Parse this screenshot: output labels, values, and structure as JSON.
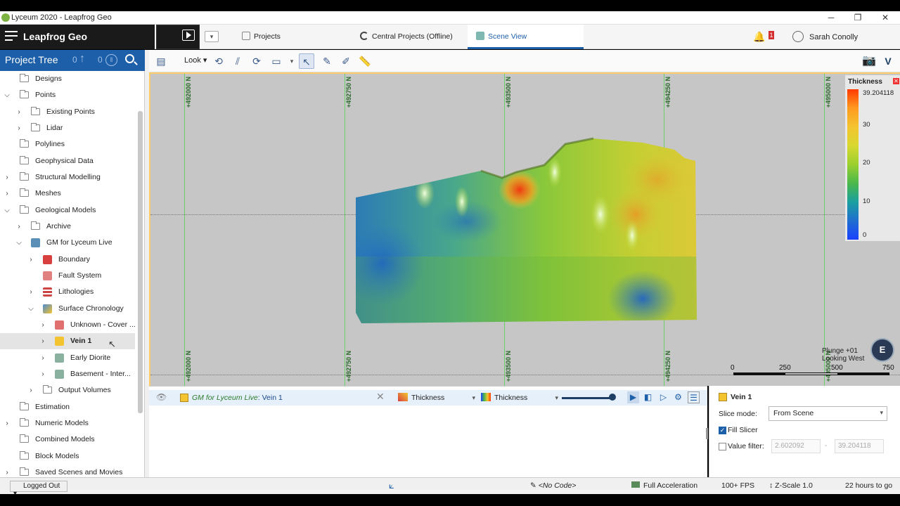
{
  "window": {
    "title": "Lyceum 2020 - Leapfrog Geo",
    "minimize": "─",
    "restore": "❐",
    "close": "✕"
  },
  "app": {
    "name": "Leapfrog Geo"
  },
  "tabs": [
    {
      "label": "Projects"
    },
    {
      "label": "Central Projects (Offline)"
    },
    {
      "label": "Scene View"
    }
  ],
  "notifications": {
    "count": "1"
  },
  "user": {
    "name": "Sarah Conolly"
  },
  "project_tree": {
    "title": "Project Tree",
    "count_a": "0",
    "count_b": "0",
    "items": [
      {
        "label": "Designs"
      },
      {
        "label": "Points"
      },
      {
        "label": "Existing Points"
      },
      {
        "label": "Lidar"
      },
      {
        "label": "Polylines"
      },
      {
        "label": "Geophysical Data"
      },
      {
        "label": "Structural Modelling"
      },
      {
        "label": "Meshes"
      },
      {
        "label": "Geological Models"
      },
      {
        "label": "Archive"
      },
      {
        "label": "GM for Lyceum Live"
      },
      {
        "label": "Boundary"
      },
      {
        "label": "Fault System"
      },
      {
        "label": "Lithologies"
      },
      {
        "label": "Surface Chronology"
      },
      {
        "label": "Unknown - Cover ..."
      },
      {
        "label": "Vein 1"
      },
      {
        "label": "Early Diorite"
      },
      {
        "label": "Basement - Inter..."
      },
      {
        "label": "Output Volumes"
      },
      {
        "label": "Estimation"
      },
      {
        "label": "Numeric Models"
      },
      {
        "label": "Combined Models"
      },
      {
        "label": "Block Models"
      },
      {
        "label": "Saved Scenes and Movies"
      }
    ]
  },
  "toolbar": {
    "look_label": "Look"
  },
  "viewport": {
    "grid_labels": [
      "+492000 N",
      "+492750 N",
      "+493500 N",
      "+494250 N",
      "+495000 N"
    ],
    "plunge": "Plunge +01",
    "looking": "Looking West",
    "compass": "E",
    "scale_labels": [
      "0",
      "250",
      "500",
      "750"
    ],
    "colorscale": {
      "title": "Thickness",
      "max": "39.204118",
      "ticks": [
        "30",
        "20",
        "10",
        "0"
      ]
    }
  },
  "layer": {
    "model": "GM for Lyceum Live",
    "separator": ":",
    "name": "Vein 1",
    "property": "Thickness",
    "colormap": "Thickness"
  },
  "properties": {
    "title": "Vein 1",
    "slice_mode_label": "Slice mode:",
    "slice_mode_value": "From Scene",
    "fill_slicer_label": "Fill Slicer",
    "value_filter_label": "Value filter:",
    "value_filter_min": "2.602092",
    "value_filter_dash": "-",
    "value_filter_max": "39.204118"
  },
  "status": {
    "login": "Logged Out",
    "code": "<No Code>",
    "acceleration": "Full Acceleration",
    "fps": "100+ FPS",
    "zscale": "Z-Scale 1.0",
    "time": "22 hours to go"
  }
}
